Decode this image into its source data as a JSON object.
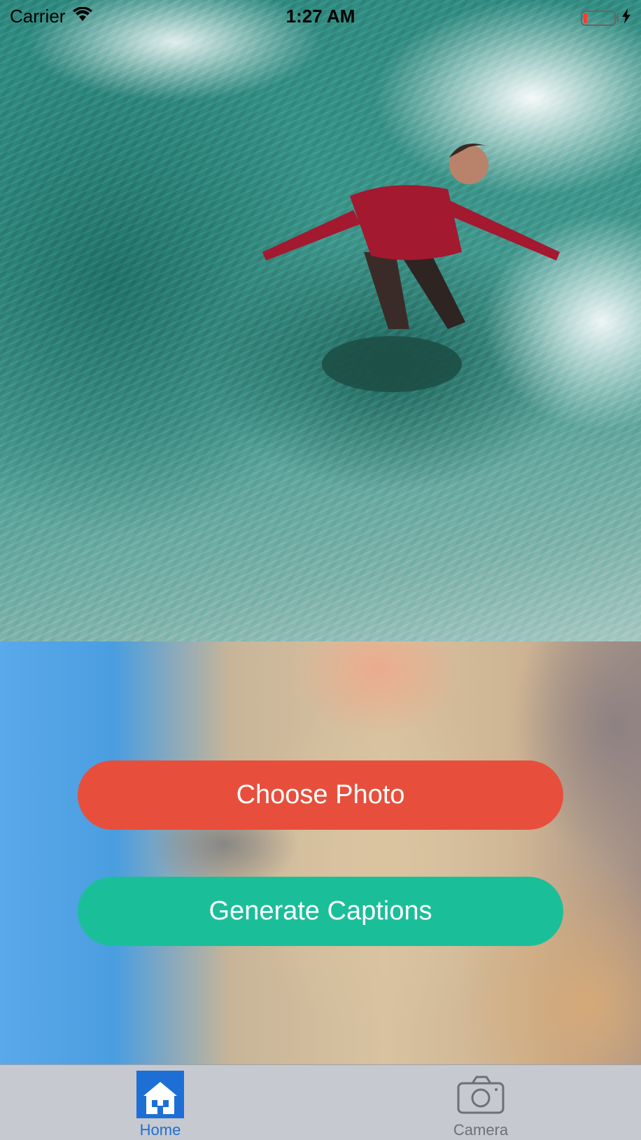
{
  "status_bar": {
    "carrier": "Carrier",
    "time": "1:27 AM",
    "battery_level": 0.12,
    "battery_color": "#ff3b30",
    "icons": [
      "wifi-icon",
      "battery-icon",
      "charging-bolt-icon"
    ]
  },
  "photo": {
    "description_icon": "surfer-photo"
  },
  "buttons": {
    "choose_photo": "Choose Photo",
    "generate_captions": "Generate Captions",
    "choose_color": "#e74f3c",
    "generate_color": "#1abf9a"
  },
  "tab_bar": {
    "tabs": [
      {
        "label": "Home",
        "icon": "home-icon",
        "selected": true,
        "color": "#1d6fd6"
      },
      {
        "label": "Camera",
        "icon": "camera-icon",
        "selected": false,
        "color": "#6f7074"
      }
    ]
  }
}
